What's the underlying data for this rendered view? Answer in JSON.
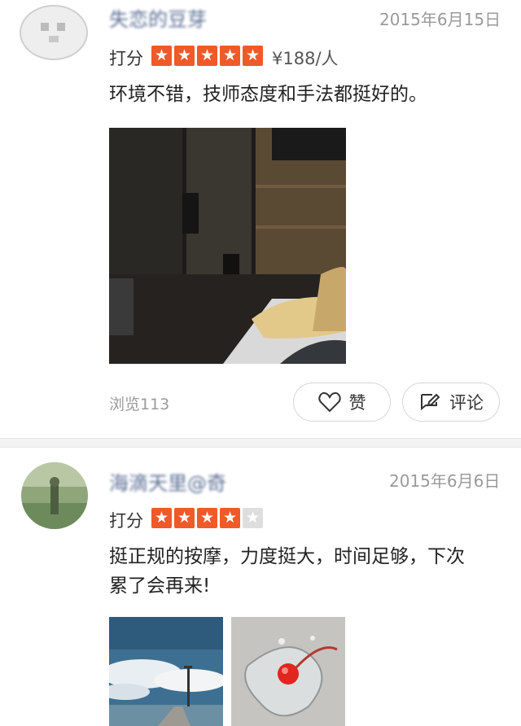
{
  "reviews": [
    {
      "user_name": "失恋的豆芽",
      "date": "2015年6月15日",
      "rating_label": "打分",
      "stars": 5,
      "price": "¥188/人",
      "text_lines": [
        "环境不错，技师态度和手法都挺好的。"
      ],
      "views": "浏览113",
      "like_label": "赞",
      "comment_label": "评论",
      "like_icon": "heart-icon",
      "comment_icon": "edit-comment-icon"
    },
    {
      "user_name": "海滴天里@奇",
      "date": "2015年6月6日",
      "rating_label": "打分",
      "stars": 4,
      "text_lines": [
        "挺正规的按摩，力度挺大，时间足够，下次",
        "累了会再来!"
      ]
    }
  ],
  "colors": {
    "star_on": "#f05a28",
    "star_off": "#dedede",
    "name": "#5b6f94",
    "meta": "#9a9a9a"
  }
}
